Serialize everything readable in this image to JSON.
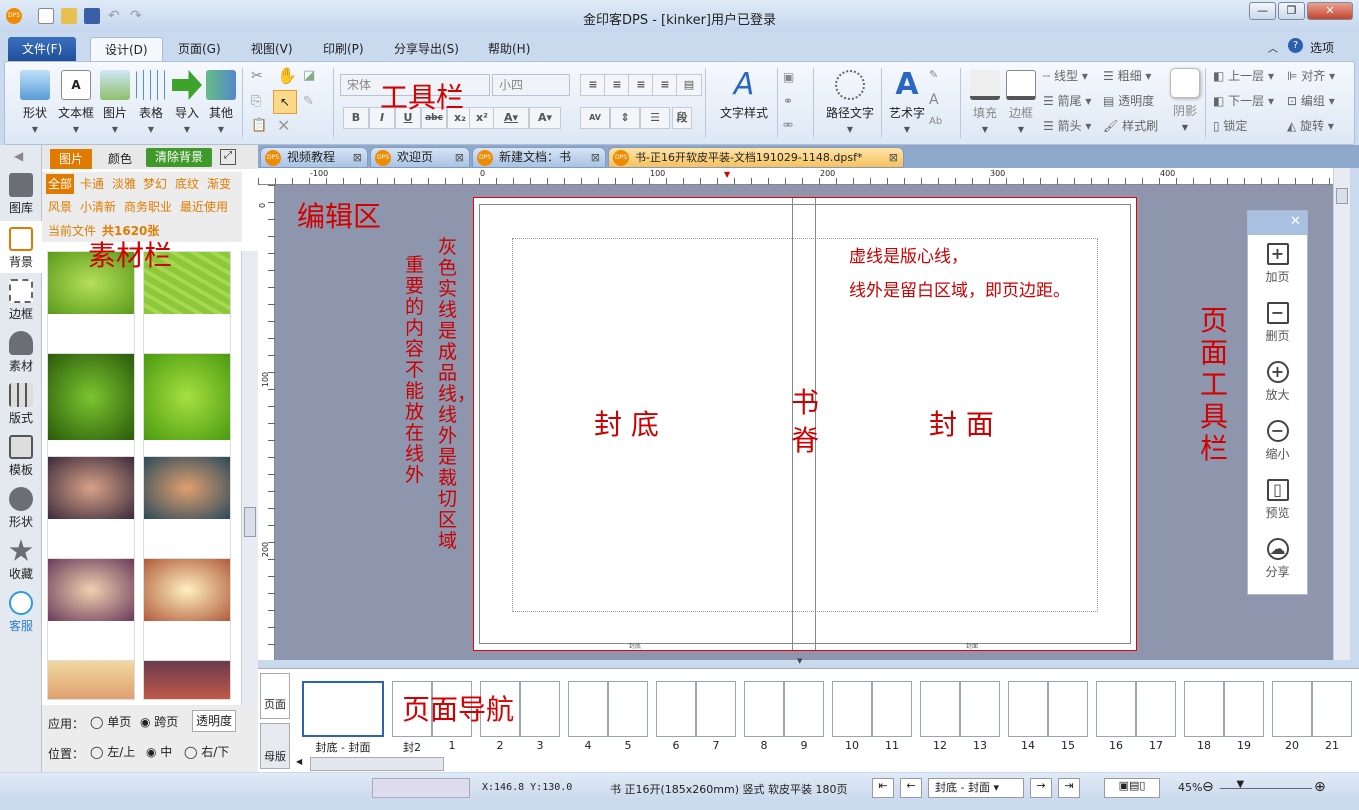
{
  "window": {
    "title": "金印客DPS - [kinker]用户已登录",
    "logo": "DPS",
    "controls": [
      "minimize",
      "restore",
      "close"
    ]
  },
  "menu": {
    "items": [
      "文件(F)",
      "设计(D)",
      "页面(G)",
      "视图(V)",
      "印刷(P)",
      "分享导出(S)",
      "帮助(H)"
    ],
    "active": "设计(D)",
    "options": "选项"
  },
  "ribbon": {
    "insert": [
      "形状",
      "文本框",
      "图片",
      "表格",
      "导入",
      "其他"
    ],
    "font": {
      "family": "宋体",
      "size": "小四"
    },
    "text_style": "文字样式",
    "path_text": "路径文字",
    "art_text": "艺术字",
    "fill": "填充",
    "border": "边框",
    "line_type": "线型",
    "arrow_tail": "箭尾",
    "arrow_head": "箭头",
    "thickness": "粗细",
    "transparency": "透明度",
    "format_brush": "样式刷",
    "shadow": "阴影",
    "layer_up": "上一层",
    "layer_down": "下一层",
    "lock": "锁定",
    "align": "对齐",
    "group": "编组",
    "rotate": "旋转"
  },
  "left_strip": [
    {
      "label": "图库",
      "icon": "gallery-icon"
    },
    {
      "label": "背景",
      "icon": "background-icon"
    },
    {
      "label": "边框",
      "icon": "border-icon"
    },
    {
      "label": "素材",
      "icon": "material-icon"
    },
    {
      "label": "版式",
      "icon": "layout-icon"
    },
    {
      "label": "模板",
      "icon": "template-icon"
    },
    {
      "label": "形状",
      "icon": "shape-icon"
    },
    {
      "label": "收藏",
      "icon": "star-icon"
    },
    {
      "label": "客服",
      "icon": "chat-icon"
    }
  ],
  "panel": {
    "tabs": [
      "图片",
      "颜色"
    ],
    "clear_bg": "清除背景",
    "categories": [
      "全部",
      "卡通",
      "淡雅",
      "梦幻",
      "底纹",
      "渐变",
      "风景",
      "小清新",
      "商务职业",
      "最近使用"
    ],
    "current": "当前文件",
    "count": "共1620张",
    "apply_label": "应用：",
    "apply_opts": [
      "单页",
      "跨页"
    ],
    "apply_selected": "跨页",
    "transparency_btn": "透明度",
    "pos_label": "位置：",
    "pos_opts": [
      "左/上",
      "中",
      "右/下"
    ],
    "pos_selected": "中"
  },
  "doc_tabs": [
    "视频教程",
    "欢迎页",
    "新建文档：书",
    "书-正16开软皮平装-文档191029-1148.dpsf*"
  ],
  "ruler": {
    "h": [
      "-100",
      "0",
      "100",
      "200",
      "300",
      "400"
    ],
    "v": [
      "0",
      "100",
      "200"
    ]
  },
  "page": {
    "back": "封 底",
    "spine": "书\n脊",
    "front": "封 面",
    "back_small": "封底",
    "front_small": "封面"
  },
  "annotations": {
    "toolbar": "工具栏",
    "edit": "编辑区",
    "material": "素材栏",
    "nav": "页面导航",
    "pagetools": "页面工具栏",
    "note1": "虚线是版心线，",
    "note2": "线外是留白区域，即页边距。",
    "note3": "灰色实线是成品线，线外是裁切区域",
    "note4": "重要的内容不能放在线外"
  },
  "page_tools": [
    {
      "label": "加页",
      "glyph": "+"
    },
    {
      "label": "删页",
      "glyph": "−"
    },
    {
      "label": "放大",
      "glyph": "+"
    },
    {
      "label": "缩小",
      "glyph": "−"
    },
    {
      "label": "预览",
      "glyph": "▯"
    },
    {
      "label": "分享",
      "glyph": "☁"
    }
  ],
  "nav": {
    "side_tabs": [
      "页面",
      "母版"
    ],
    "pages": [
      "封底 - 封面",
      "封2",
      "1",
      "2",
      "3",
      "4",
      "5",
      "6",
      "7",
      "8",
      "9",
      "10",
      "11",
      "12",
      "13",
      "14",
      "15",
      "16",
      "17",
      "18",
      "19",
      "20",
      "21"
    ]
  },
  "status": {
    "coords": "X:146.8  Y:130.0",
    "doc_info": "书 正16开(185x260mm) 竖式 软皮平装 180页",
    "current_page": "封底 - 封面",
    "zoom": "45%",
    "zoom_level": 0.45
  },
  "colors": {
    "accent": "#e07b00",
    "annotation": "#d40000",
    "canvas": "#8d96ad",
    "clear_bg": "#3f9a2b"
  }
}
